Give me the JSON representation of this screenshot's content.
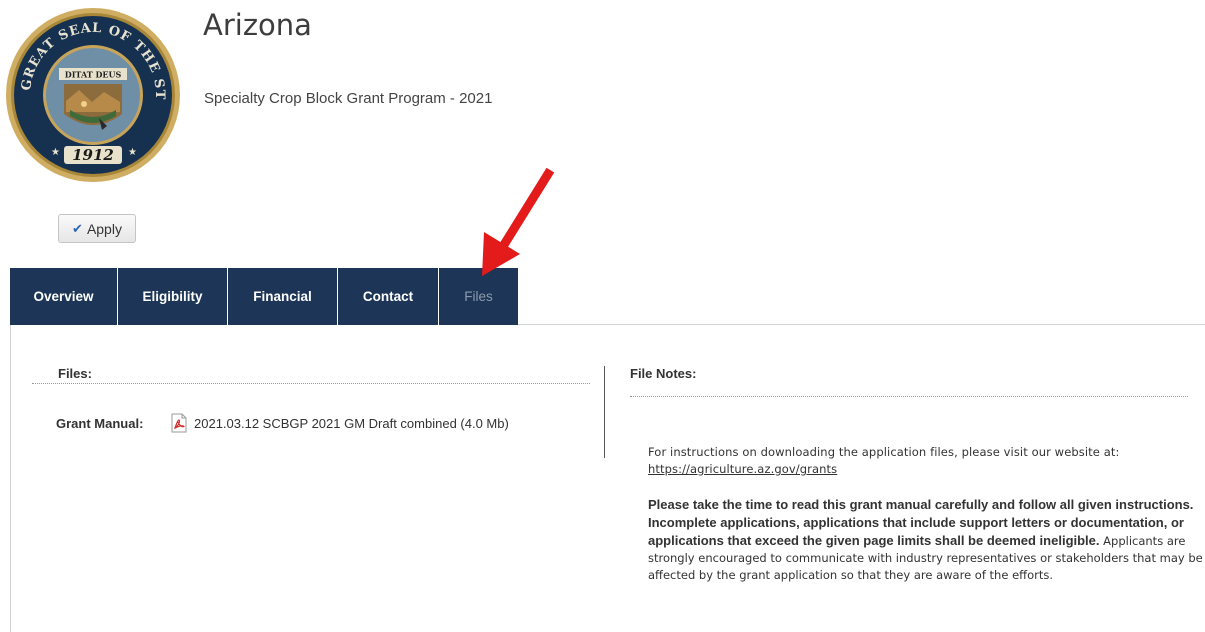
{
  "header": {
    "org_name": "Arizona",
    "program_name": "Specialty Crop Block Grant Program - 2021",
    "seal": {
      "text_top": "GREAT SEAL OF THE STATE OF ARIZONA",
      "motto": "DITAT DEUS",
      "year": "1912"
    }
  },
  "apply_button": {
    "label": "Apply",
    "icon": "check-icon"
  },
  "tabs": [
    {
      "label": "Overview",
      "active": false
    },
    {
      "label": "Eligibility",
      "active": false
    },
    {
      "label": "Financial",
      "active": false
    },
    {
      "label": "Contact",
      "active": false
    },
    {
      "label": "Files",
      "active": true
    }
  ],
  "files_panel": {
    "heading": "Files:",
    "items": [
      {
        "label": "Grant Manual:",
        "file_name": "2021.03.12 SCBGP 2021 GM Draft combined (4.0 Mb)",
        "icon": "pdf-icon"
      }
    ]
  },
  "notes_panel": {
    "heading": "File Notes:",
    "instructions_text": "For instructions on downloading the application files, please visit our website at: ",
    "instructions_link": "https://agriculture.az.gov/grants ",
    "notice_bold": "Please take the time to read this grant manual carefully and follow all given instructions.  Incomplete applications, applications that include support letters or documentation, or applications that exceed the given page limits shall be deemed ineligible.",
    "notice_text": " Applicants are strongly encouraged to communicate with industry representatives or stakeholders that may be affected by the grant application so that they are aware of the efforts."
  },
  "colors": {
    "tab_bg": "#1d3657",
    "tab_text": "#ffffff",
    "tab_active_text": "#8e9aab",
    "arrow": "#e31b1b"
  }
}
